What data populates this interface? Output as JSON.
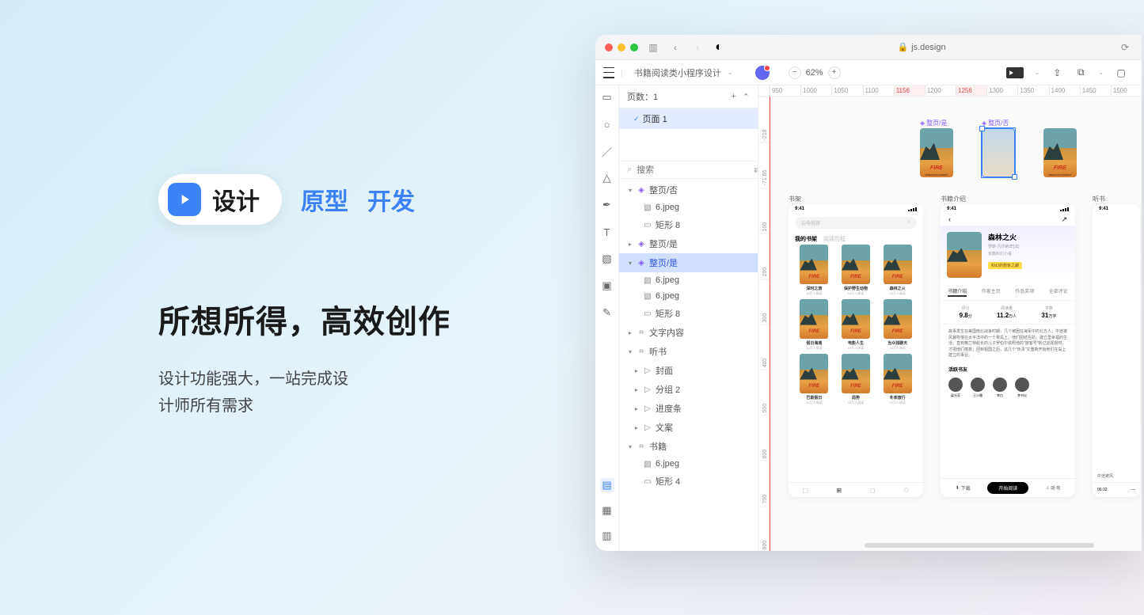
{
  "promo": {
    "logo_text": "设计",
    "tab_prototype": "原型",
    "tab_develop": "开发",
    "title": "所想所得，高效创作",
    "subtitle_line1": "设计功能强大，一站完成设",
    "subtitle_line2": "计师所有需求"
  },
  "browser": {
    "url": "js.design",
    "lock": "🔒",
    "reload": "⟳"
  },
  "toolbar": {
    "doc_title": "书籍阅读类小程序设计",
    "zoom": "62%",
    "minus": "−",
    "plus": "+"
  },
  "pages_panel": {
    "header": "页数：1",
    "plus": "+",
    "collapse": "⌃",
    "page1": "页面 1",
    "search_placeholder": "搜索"
  },
  "layers": [
    {
      "nest": 0,
      "caret": "open",
      "ico": "comp",
      "label": "整页/否"
    },
    {
      "nest": 1,
      "caret": "none",
      "ico": "img",
      "label": "6.jpeg"
    },
    {
      "nest": 1,
      "caret": "none",
      "ico": "rect",
      "label": "矩形 8"
    },
    {
      "nest": 0,
      "caret": "closed",
      "ico": "comp",
      "label": "整页/是"
    },
    {
      "nest": 0,
      "caret": "open",
      "ico": "comp",
      "label": "整页/是",
      "selected": true
    },
    {
      "nest": 1,
      "caret": "none",
      "ico": "img",
      "label": "6.jpeg"
    },
    {
      "nest": 1,
      "caret": "none",
      "ico": "img",
      "label": "6.jpeg"
    },
    {
      "nest": 1,
      "caret": "none",
      "ico": "rect",
      "label": "矩形 8"
    },
    {
      "nest": 0,
      "caret": "closed",
      "ico": "frame",
      "label": "文字内容"
    },
    {
      "nest": 0,
      "caret": "open",
      "ico": "frame",
      "label": "听书"
    },
    {
      "nest": 1,
      "caret": "closed",
      "ico": "folder",
      "label": "封面"
    },
    {
      "nest": 1,
      "caret": "closed",
      "ico": "folder",
      "label": "分组 2"
    },
    {
      "nest": 1,
      "caret": "closed",
      "ico": "folder",
      "label": "进度条"
    },
    {
      "nest": 1,
      "caret": "closed",
      "ico": "folder",
      "label": "文案"
    },
    {
      "nest": 0,
      "caret": "open",
      "ico": "frame",
      "label": "书籍"
    },
    {
      "nest": 1,
      "caret": "none",
      "ico": "img",
      "label": "6.jpeg"
    },
    {
      "nest": 1,
      "caret": "none",
      "ico": "rect",
      "label": "矩形 4"
    }
  ],
  "ruler_h": [
    "950",
    "1000",
    "1050",
    "1100",
    "1156",
    "1200",
    "1256",
    "1300",
    "1350",
    "1400",
    "1450",
    "1500"
  ],
  "ruler_v": [
    "-218",
    "-71.65",
    "100",
    "200",
    "300",
    "400",
    "500",
    "600",
    "700",
    "800"
  ],
  "canvas": {
    "comp_label_yes": "整页/是",
    "comp_label_no": "整页/否",
    "frame_bookshelf": "书架",
    "frame_detail": "书籍介绍",
    "frame_listen": "听书"
  },
  "phone": {
    "time": "9:41",
    "search_placeholder": "云电视容",
    "tab_my_shelf": "我的书架",
    "tab_recent": "阅读历程",
    "books_row1": [
      "深时之旅",
      "保护野生动物",
      "森林之火"
    ],
    "books_row2": [
      "假日海滩",
      "电影人生",
      "当众独聊天"
    ],
    "books_row3": [
      "巴斯假日",
      "局势",
      "冬季旅行"
    ],
    "book_sub": "10万人阅读"
  },
  "phone2": {
    "book_title": "森林之火",
    "author": "罗斯·凡尔纳辛[法]",
    "genre": "长篇科幻小说",
    "badge": "科幻的想象之巅",
    "tabs": [
      "书籍介绍",
      "作家主页",
      "作品奖项",
      "全部评论"
    ],
    "stat_labels": [
      "评分",
      "阅读量",
      "字数"
    ],
    "stat_score": "9.8",
    "stat_score_unit": "分",
    "stat_reads": "11.2",
    "stat_reads_unit": "万人",
    "stat_words": "31",
    "stat_words_unit": "万字",
    "desc": "故事发生在美国南北战争时期，几个被困在海军中的北方人，中途被风暴吹落在太平洋中的一个荒岛上。他们团结互助，建立里幸福的生活；直到格兰特船长的儿子罗伯尔依照他的\"旅客号\"帆过巡视督时，才把他们搭救；回到祖国之后，这几个\"负责\"又重新开始他们在岛上建立的事业。",
    "friends_title": "活跃书友",
    "friends": [
      "梁光芳",
      "王小雅",
      "李白",
      "李书仪"
    ],
    "action_download": "下载",
    "action_start": "开始阅读",
    "action_listen": "听书"
  },
  "phone3": {
    "line1": "中途被风",
    "time_progress": "06:32"
  }
}
